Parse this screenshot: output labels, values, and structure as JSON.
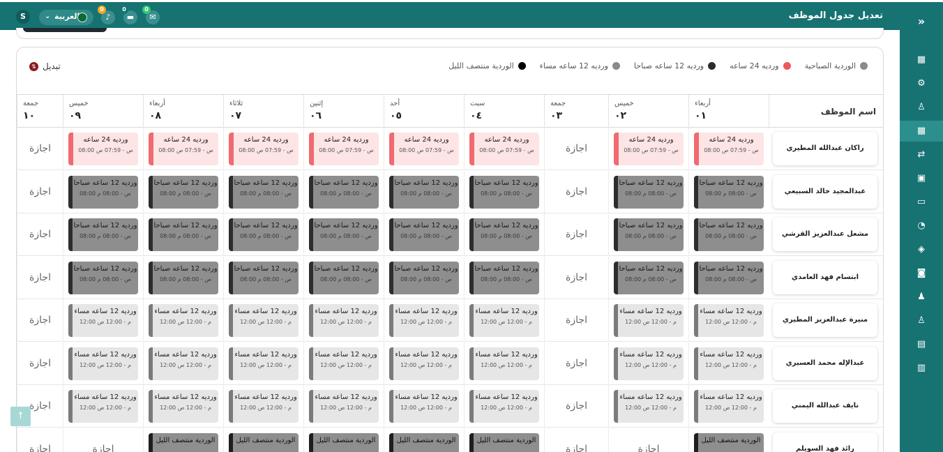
{
  "header": {
    "title": "تعديل جدول الموظف",
    "user_initial": "S",
    "language": "العربية",
    "notifications": [
      {
        "icon": "mail-icon",
        "count": "0",
        "color": "#2ecc71"
      },
      {
        "icon": "chat-icon",
        "count": "0",
        "color": "#177272"
      },
      {
        "icon": "bell-icon",
        "count": "0",
        "color": "#f5a623"
      }
    ]
  },
  "sidebar": {
    "items": [
      {
        "icon": "grid-icon",
        "glyph": "▦"
      },
      {
        "icon": "gears-icon",
        "glyph": "⚙"
      },
      {
        "icon": "user-icon",
        "glyph": "♙"
      },
      {
        "icon": "calendar-icon",
        "glyph": "▦"
      },
      {
        "icon": "swap-icon",
        "glyph": "⇄"
      },
      {
        "icon": "calendar-check-icon",
        "glyph": "▣"
      },
      {
        "icon": "id-card-icon",
        "glyph": "▭"
      },
      {
        "icon": "clock-icon",
        "glyph": "◔"
      },
      {
        "icon": "layers-icon",
        "glyph": "◈"
      },
      {
        "icon": "money-icon",
        "glyph": "◙"
      },
      {
        "icon": "org-chart-icon",
        "glyph": "♟"
      },
      {
        "icon": "user-x-icon",
        "glyph": "♙"
      },
      {
        "icon": "briefcase-icon",
        "glyph": "▤"
      },
      {
        "icon": "document-icon",
        "glyph": "▥"
      }
    ]
  },
  "legend": [
    {
      "label": "الوردية الصباحية",
      "color": "#8a8a8a"
    },
    {
      "label": "ورديه 24 ساعه",
      "color": "#f0565b"
    },
    {
      "label": "ورديه 12 ساعه صباحا",
      "color": "#2b2b2b"
    },
    {
      "label": "ورديه 12 ساعه مساء",
      "color": "#8a8a8a"
    },
    {
      "label": "الوردية منتصف الليل",
      "color": "#000000"
    }
  ],
  "swap_label": "تبديل",
  "employee_header": "اسم الموظف",
  "days": [
    {
      "name": "أربعاء",
      "num": "٠١"
    },
    {
      "name": "خميس",
      "num": "٠٢"
    },
    {
      "name": "جمعة",
      "num": "٠٣"
    },
    {
      "name": "سبت",
      "num": "٠٤"
    },
    {
      "name": "أحد",
      "num": "٠٥"
    },
    {
      "name": "إثنين",
      "num": "٠٦"
    },
    {
      "name": "ثلاثاء",
      "num": "٠٧"
    },
    {
      "name": "أربعاء",
      "num": "٠٨"
    },
    {
      "name": "خميس",
      "num": "٠٩"
    },
    {
      "name": "جمعة",
      "num": "١٠"
    }
  ],
  "shift_types": {
    "h24": {
      "label": "ورديه 24 ساعه",
      "time": "08:00 ص - 07:59 ص",
      "style": "red"
    },
    "am12": {
      "label": "ورديه 12 ساعه صباحا",
      "time": "08:00 ص - 08:00 م",
      "style": "dark"
    },
    "pm12": {
      "label": "ورديه 12 ساعه مساء",
      "time": "12:00 م - 12:00 ص",
      "style": "light"
    },
    "mid": {
      "label": "الوردية منتصف الليل",
      "time": "",
      "style": "midnight"
    }
  },
  "off_label": "اجازة",
  "rows": [
    {
      "name": "راكان عبدالله المطيري",
      "cells": [
        "h24",
        "h24",
        "off",
        "h24",
        "h24",
        "h24",
        "h24",
        "h24",
        "h24",
        "off"
      ]
    },
    {
      "name": "عبدالمجيد خالد السبيعي",
      "cells": [
        "am12",
        "am12",
        "off",
        "am12",
        "am12",
        "am12",
        "am12",
        "am12",
        "am12",
        "off"
      ]
    },
    {
      "name": "مشعل عبدالعزيز القرشي",
      "cells": [
        "am12",
        "am12",
        "off",
        "am12",
        "am12",
        "am12",
        "am12",
        "am12",
        "am12",
        "off"
      ]
    },
    {
      "name": "ابتسام فهد العامدي",
      "cells": [
        "am12",
        "am12",
        "off",
        "am12",
        "am12",
        "am12",
        "am12",
        "am12",
        "am12",
        "off"
      ]
    },
    {
      "name": "منيرة عبدالعزيز المطيري",
      "cells": [
        "pm12",
        "pm12",
        "off",
        "pm12",
        "pm12",
        "pm12",
        "pm12",
        "pm12",
        "pm12",
        "off"
      ]
    },
    {
      "name": "عبدالإله محمد العسيري",
      "cells": [
        "pm12",
        "pm12",
        "off",
        "pm12",
        "pm12",
        "pm12",
        "pm12",
        "pm12",
        "pm12",
        "off"
      ]
    },
    {
      "name": "نايف عبدالله اليمني",
      "cells": [
        "pm12",
        "pm12",
        "off",
        "pm12",
        "pm12",
        "pm12",
        "pm12",
        "pm12",
        "pm12",
        "off"
      ]
    },
    {
      "name": "رائد فهد السويلم",
      "cells": [
        "mid",
        "off",
        "off",
        "mid",
        "mid",
        "mid",
        "mid",
        "mid",
        "off",
        "off"
      ]
    }
  ]
}
